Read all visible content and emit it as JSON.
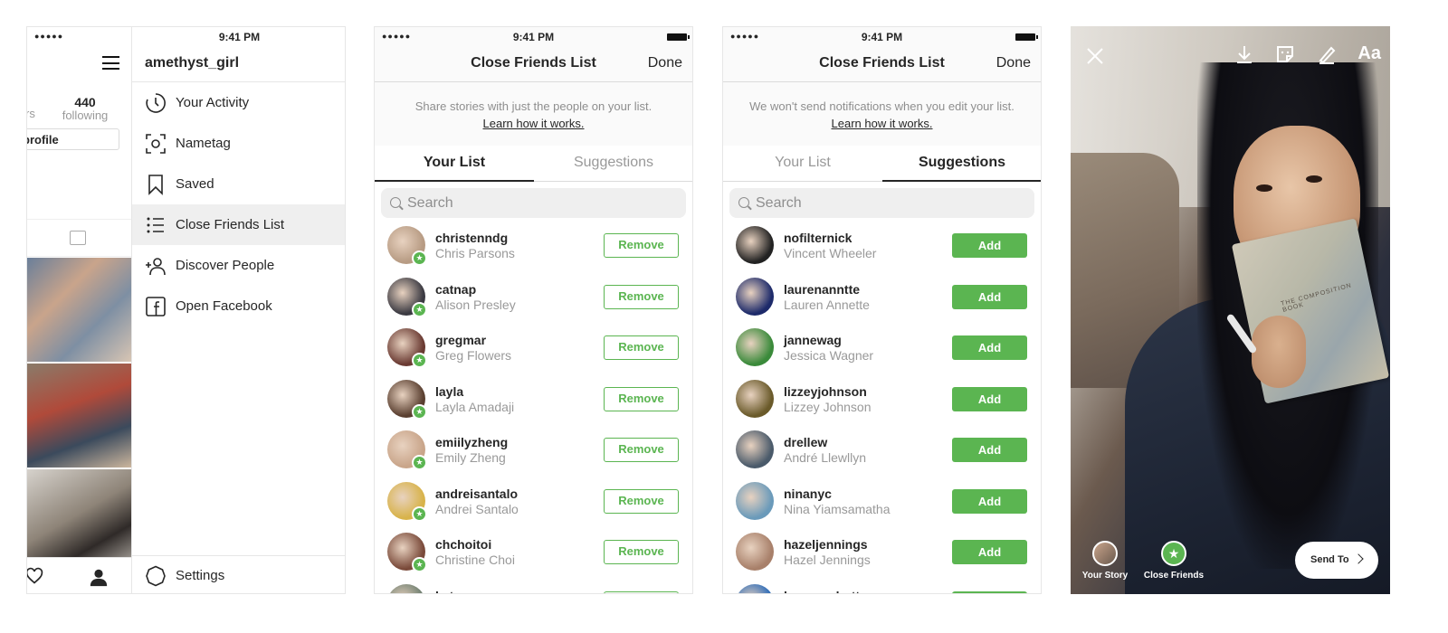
{
  "status_bar": {
    "time": "9:41 PM",
    "signal": "●●●●●"
  },
  "colors": {
    "accent_green": "#5bb551",
    "text": "#262626",
    "muted": "#8e8e8e"
  },
  "profile": {
    "partial_stat_label": "rs",
    "following_count": "440",
    "following_label": "following",
    "edit_button_partial": "profile"
  },
  "drawer": {
    "username": "amethyst_girl",
    "items": [
      {
        "label": "Your Activity",
        "icon": "activity-clock-icon"
      },
      {
        "label": "Nametag",
        "icon": "nametag-icon"
      },
      {
        "label": "Saved",
        "icon": "bookmark-icon"
      },
      {
        "label": "Close Friends List",
        "icon": "list-icon",
        "active": true
      },
      {
        "label": "Discover People",
        "icon": "add-person-icon"
      },
      {
        "label": "Open Facebook",
        "icon": "facebook-icon"
      }
    ],
    "settings_label": "Settings"
  },
  "your_list_screen": {
    "title": "Close Friends List",
    "done": "Done",
    "info_text": "Share stories with just the people on your list.",
    "info_link": "Learn how it works.",
    "tabs": [
      "Your List",
      "Suggestions"
    ],
    "active_tab": 0,
    "search_placeholder": "Search",
    "button_label": "Remove",
    "people": [
      {
        "username": "christenndg",
        "name": "Chris Parsons",
        "color": "#b79b83"
      },
      {
        "username": "catnap",
        "name": "Alison Presley",
        "color": "#3b3a42"
      },
      {
        "username": "gregmar",
        "name": "Greg Flowers",
        "color": "#6a3a32"
      },
      {
        "username": "layla",
        "name": "Layla Amadaji",
        "color": "#5a3f30"
      },
      {
        "username": "emiilyzheng",
        "name": "Emily Zheng",
        "color": "#c9a58a"
      },
      {
        "username": "andreisantalo",
        "name": "Andrei Santalo",
        "color": "#d8b34a"
      },
      {
        "username": "chchoitoi",
        "name": "Christine Choi",
        "color": "#7a4a3a"
      },
      {
        "username": "kstang",
        "name": "",
        "color": "#6f7f70"
      }
    ]
  },
  "suggestions_screen": {
    "title": "Close Friends List",
    "done": "Done",
    "info_text": "We won't send notifications when you edit your list.",
    "info_link": "Learn how it works.",
    "tabs": [
      "Your List",
      "Suggestions"
    ],
    "active_tab": 1,
    "search_placeholder": "Search",
    "button_label": "Add",
    "people": [
      {
        "username": "nofilternick",
        "name": "Vincent Wheeler",
        "color": "#222222"
      },
      {
        "username": "laurenanntte",
        "name": "Lauren Annette",
        "color": "#1d2a6a"
      },
      {
        "username": "jannewag",
        "name": "Jessica Wagner",
        "color": "#3a8a3a"
      },
      {
        "username": "lizzeyjohnson",
        "name": "Lizzey Johnson",
        "color": "#6a5a2a"
      },
      {
        "username": "drellew",
        "name": "André Llewllyn",
        "color": "#4a5a6a"
      },
      {
        "username": "ninanyc",
        "name": "Nina Yiamsamatha",
        "color": "#6a9aba"
      },
      {
        "username": "hazeljennings",
        "name": "Hazel Jennings",
        "color": "#a8806a"
      },
      {
        "username": "laurenschutte",
        "name": "",
        "color": "#2a6ab8"
      }
    ]
  },
  "story": {
    "aa_label": "Aa",
    "book_title": "THE COMPOSITION BOOK",
    "your_story_label": "Your Story",
    "close_friends_label": "Close Friends",
    "send_to_label": "Send To"
  }
}
